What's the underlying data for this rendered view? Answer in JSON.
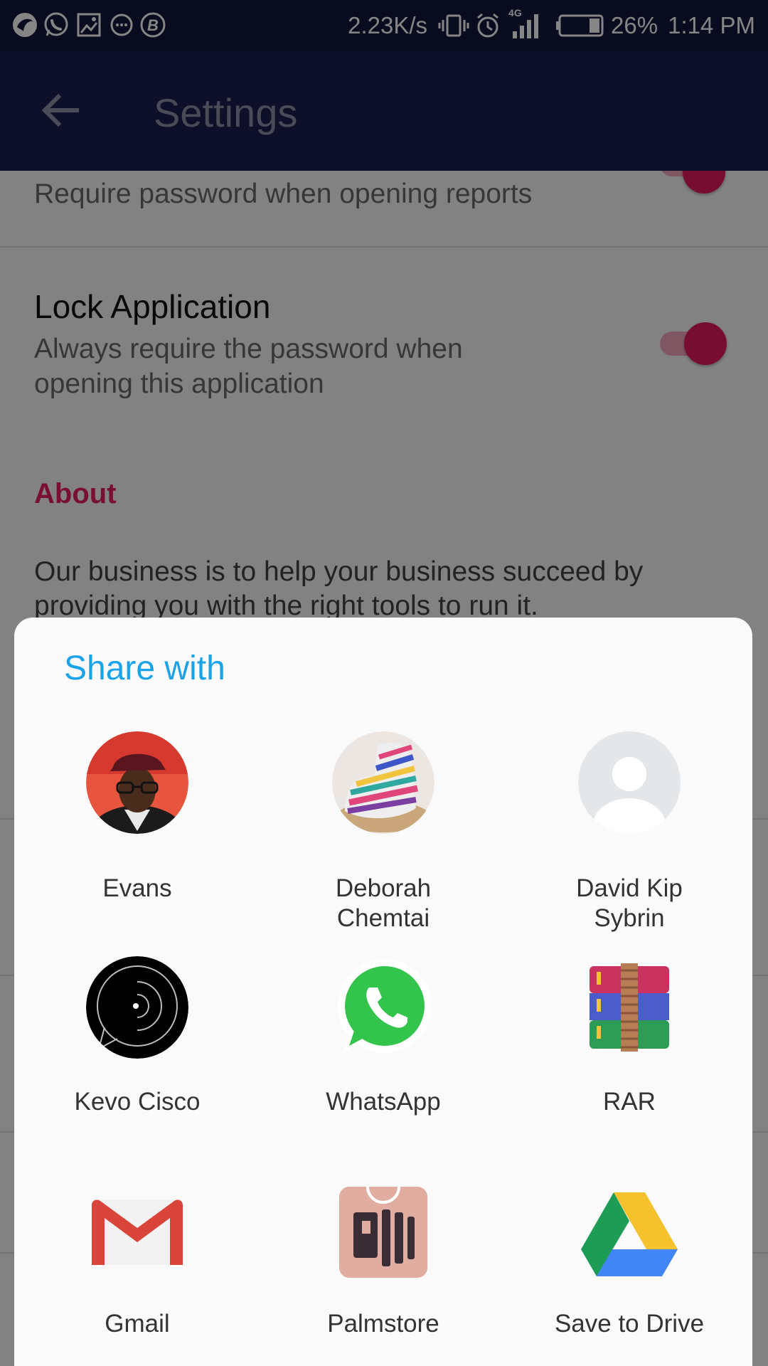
{
  "status_bar": {
    "network_speed": "2.23K/s",
    "network_type": "4G",
    "battery": "26%",
    "time": "1:14 PM",
    "left_icons": [
      "bird-app-icon",
      "whatsapp-icon",
      "gallery-icon",
      "messenger-icon",
      "b-app-icon"
    ]
  },
  "app_bar": {
    "title": "Settings",
    "back_icon": "back-arrow-icon"
  },
  "settings": {
    "password_reports_subtitle": "Require password when opening reports",
    "lock_app": {
      "title": "Lock Application",
      "subtitle_line1": "Always require the password when",
      "subtitle_line2": "opening this application",
      "enabled": true
    },
    "about": {
      "header": "About",
      "text_line1": "Our business is to help your business succeed by",
      "text_line2": "providing you with the right tools to run it."
    }
  },
  "share_sheet": {
    "title": "Share with",
    "targets": [
      {
        "label_line1": "Evans",
        "label_line2": "",
        "icon": "contact-photo-evans"
      },
      {
        "label_line1": "Deborah",
        "label_line2": "Chemtai",
        "icon": "contact-photo-deborah"
      },
      {
        "label_line1": "David Kip",
        "label_line2": "Sybrin",
        "icon": "default-contact-icon"
      },
      {
        "label_line1": "Kevo Cisco",
        "label_line2": "",
        "icon": "contact-photo-kevo"
      },
      {
        "label_line1": "WhatsApp",
        "label_line2": "",
        "icon": "whatsapp-icon"
      },
      {
        "label_line1": "RAR",
        "label_line2": "",
        "icon": "rar-icon"
      },
      {
        "label_line1": "Gmail",
        "label_line2": "",
        "icon": "gmail-icon"
      },
      {
        "label_line1": "Palmstore",
        "label_line2": "",
        "icon": "palmstore-icon"
      },
      {
        "label_line1": "Save to Drive",
        "label_line2": "",
        "icon": "google-drive-icon"
      }
    ]
  },
  "colors": {
    "status_bar": "#12163a",
    "app_bar": "#1b1f4f",
    "accent_pink": "#e91e63",
    "share_title": "#1aa3e8"
  }
}
